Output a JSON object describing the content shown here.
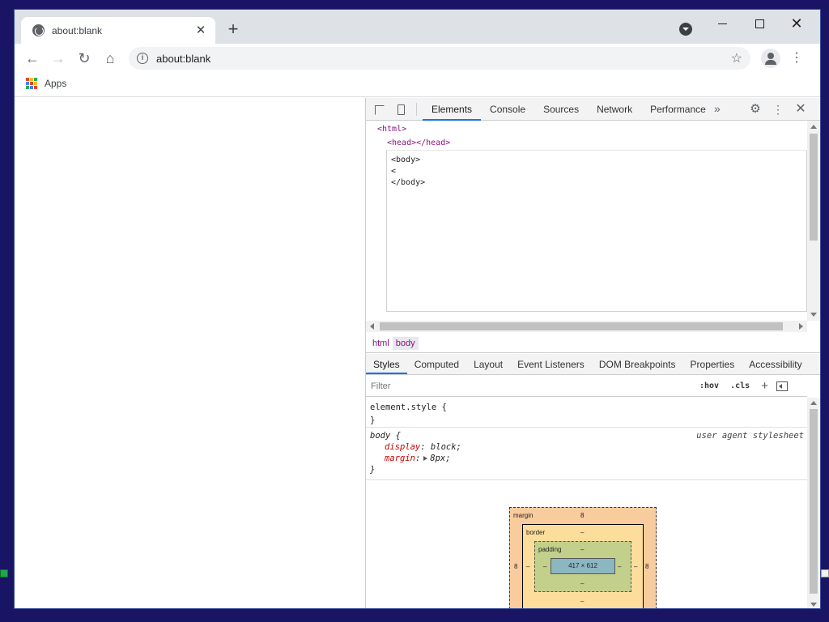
{
  "browser": {
    "tab_title": "about:blank",
    "new_tab_icon": "+",
    "url": "about:blank",
    "bookmarks": [
      {
        "label": "Apps"
      }
    ]
  },
  "devtools": {
    "tabs": [
      "Elements",
      "Console",
      "Sources",
      "Network",
      "Performance"
    ],
    "active_tab": "Elements",
    "more_tabs": "»",
    "dom": {
      "html_open": "<html>",
      "head": "<head></head>",
      "editor_text": "<body>\n<\n</body>"
    },
    "breadcrumbs": [
      "html",
      "body"
    ],
    "selected_breadcrumb": "body",
    "subtabs": [
      "Styles",
      "Computed",
      "Layout",
      "Event Listeners",
      "DOM Breakpoints",
      "Properties",
      "Accessibility"
    ],
    "active_subtab": "Styles",
    "filter": {
      "placeholder": "Filter",
      "value": ""
    },
    "hov_label": ":hov",
    "cls_label": ".cls",
    "element_style": {
      "selector": "element.style {",
      "close": "}"
    },
    "body_rule": {
      "selector": "body {",
      "source": "user agent stylesheet",
      "props": [
        {
          "name": "display",
          "value": "block;"
        },
        {
          "name": "margin",
          "value": "8px;"
        }
      ],
      "close": "}"
    },
    "box_model": {
      "margin_label": "margin",
      "margin_top": "8",
      "margin_left": "8",
      "margin_right": "8",
      "margin_bottom": "–",
      "border_label": "border",
      "border_top": "–",
      "border_left": "–",
      "border_right": "–",
      "border_bottom": "–",
      "padding_label": "padding",
      "padding_top": "–",
      "padding_left": "–",
      "padding_right": "–",
      "padding_bottom": "–",
      "content_size": "417 × 612"
    }
  },
  "colors": {
    "desktop": "#1a1465",
    "accent": "#1a73e8",
    "tag": "#881280",
    "property": "#c80000"
  },
  "icons": [
    "globe-icon",
    "close-icon",
    "plus-icon",
    "back-icon",
    "forward-icon",
    "reload-icon",
    "home-icon",
    "info-icon",
    "star-icon",
    "profile-icon",
    "menu-icon",
    "apps-icon",
    "inspect-icon",
    "device-toolbar-icon",
    "gear-icon"
  ]
}
